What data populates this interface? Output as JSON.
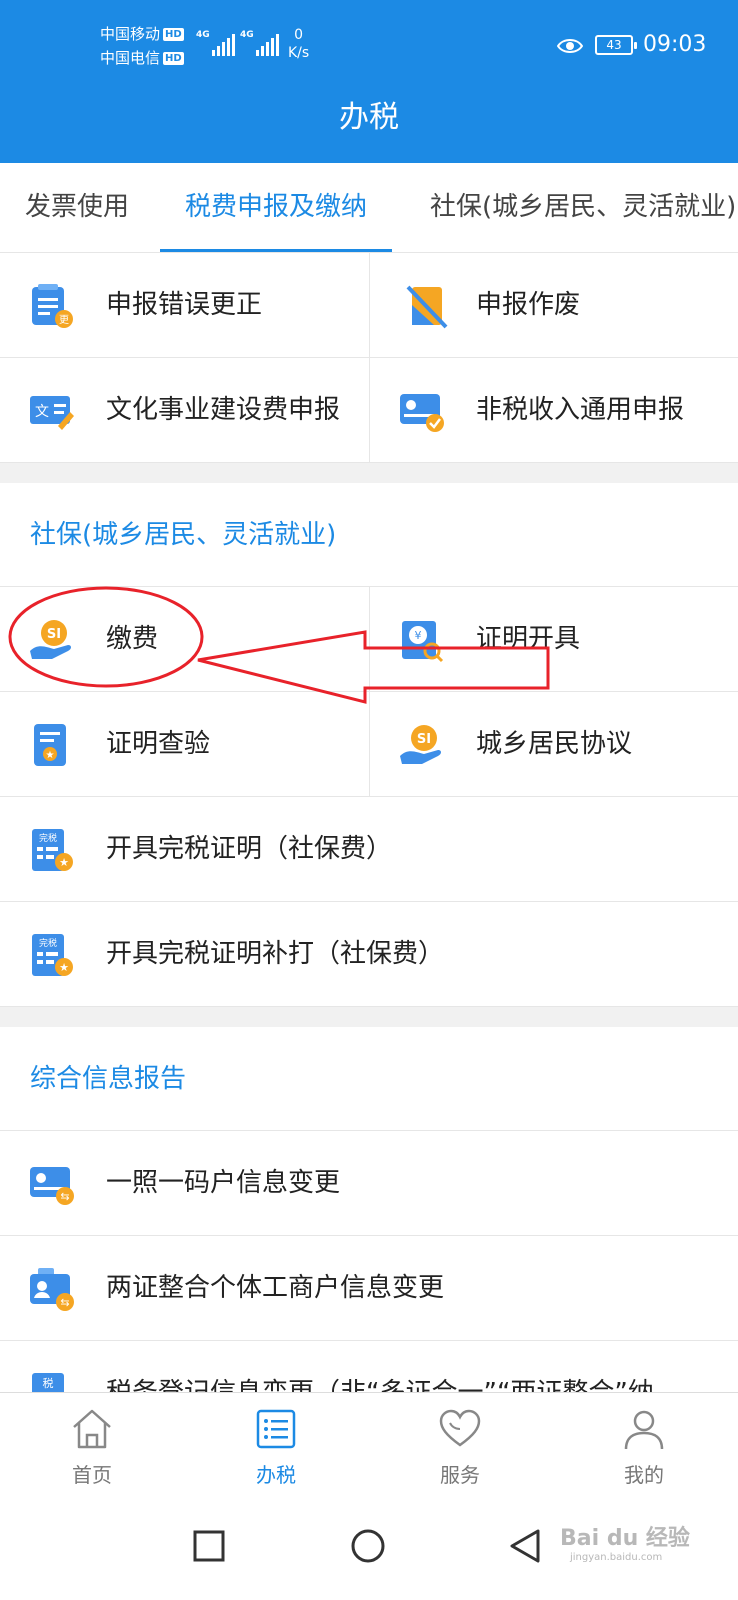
{
  "status_bar": {
    "carrier1": "中国移动",
    "carrier2": "中国电信",
    "hd": "HD",
    "net1": "4G",
    "net2": "4G",
    "speed_value": "0",
    "speed_unit": "K/s",
    "battery": "43",
    "time": "09:03"
  },
  "header": {
    "title": "办税"
  },
  "tabs": [
    {
      "label": "发票使用",
      "active": false
    },
    {
      "label": "税费申报及缴纳",
      "active": true
    },
    {
      "label": "社保(城乡居民、灵活就业)",
      "active": false
    }
  ],
  "declare_grid": [
    {
      "label": "申报错误更正",
      "icon": "doc-correct-icon"
    },
    {
      "label": "申报作废",
      "icon": "doc-void-icon"
    },
    {
      "label": "文化事业建设费申报",
      "icon": "culture-fee-icon"
    },
    {
      "label": "非税收入通用申报",
      "icon": "nontax-income-icon"
    }
  ],
  "social_section": {
    "title": "社保(城乡居民、灵活就业)",
    "items": [
      {
        "label": "缴费",
        "icon": "si-payment-icon"
      },
      {
        "label": "证明开具",
        "icon": "certificate-search-icon"
      },
      {
        "label": "证明查验",
        "icon": "certificate-verify-icon"
      },
      {
        "label": "城乡居民协议",
        "icon": "si-agreement-icon"
      },
      {
        "label": "开具完税证明（社保费）",
        "icon": "tax-paid-cert-icon",
        "badge": "完税"
      },
      {
        "label": "开具完税证明补打（社保费）",
        "icon": "tax-paid-reprint-icon",
        "badge": "完税"
      }
    ]
  },
  "info_section": {
    "title": "综合信息报告",
    "items": [
      {
        "label": "一照一码户信息变更",
        "icon": "info-change-icon"
      },
      {
        "label": "两证整合个体工商户信息变更",
        "icon": "merchant-change-icon"
      },
      {
        "label": "税务登记信息变更（非“多证合一”“两证整合”纳",
        "icon": "tax-registration-icon",
        "badge": "税"
      }
    ]
  },
  "bottom_nav": [
    {
      "label": "首页",
      "icon": "home-icon",
      "active": false
    },
    {
      "label": "办税",
      "icon": "list-icon",
      "active": true
    },
    {
      "label": "服务",
      "icon": "heart-icon",
      "active": false
    },
    {
      "label": "我的",
      "icon": "user-icon",
      "active": false
    }
  ],
  "watermark": {
    "main": "Bai du 经验",
    "sub": "jingyan.baidu.com"
  },
  "colors": {
    "primary": "#1c8ae4",
    "annotation": "#e8222a",
    "divider": "#e6e6e6",
    "section_gap": "#f1f1f1"
  }
}
